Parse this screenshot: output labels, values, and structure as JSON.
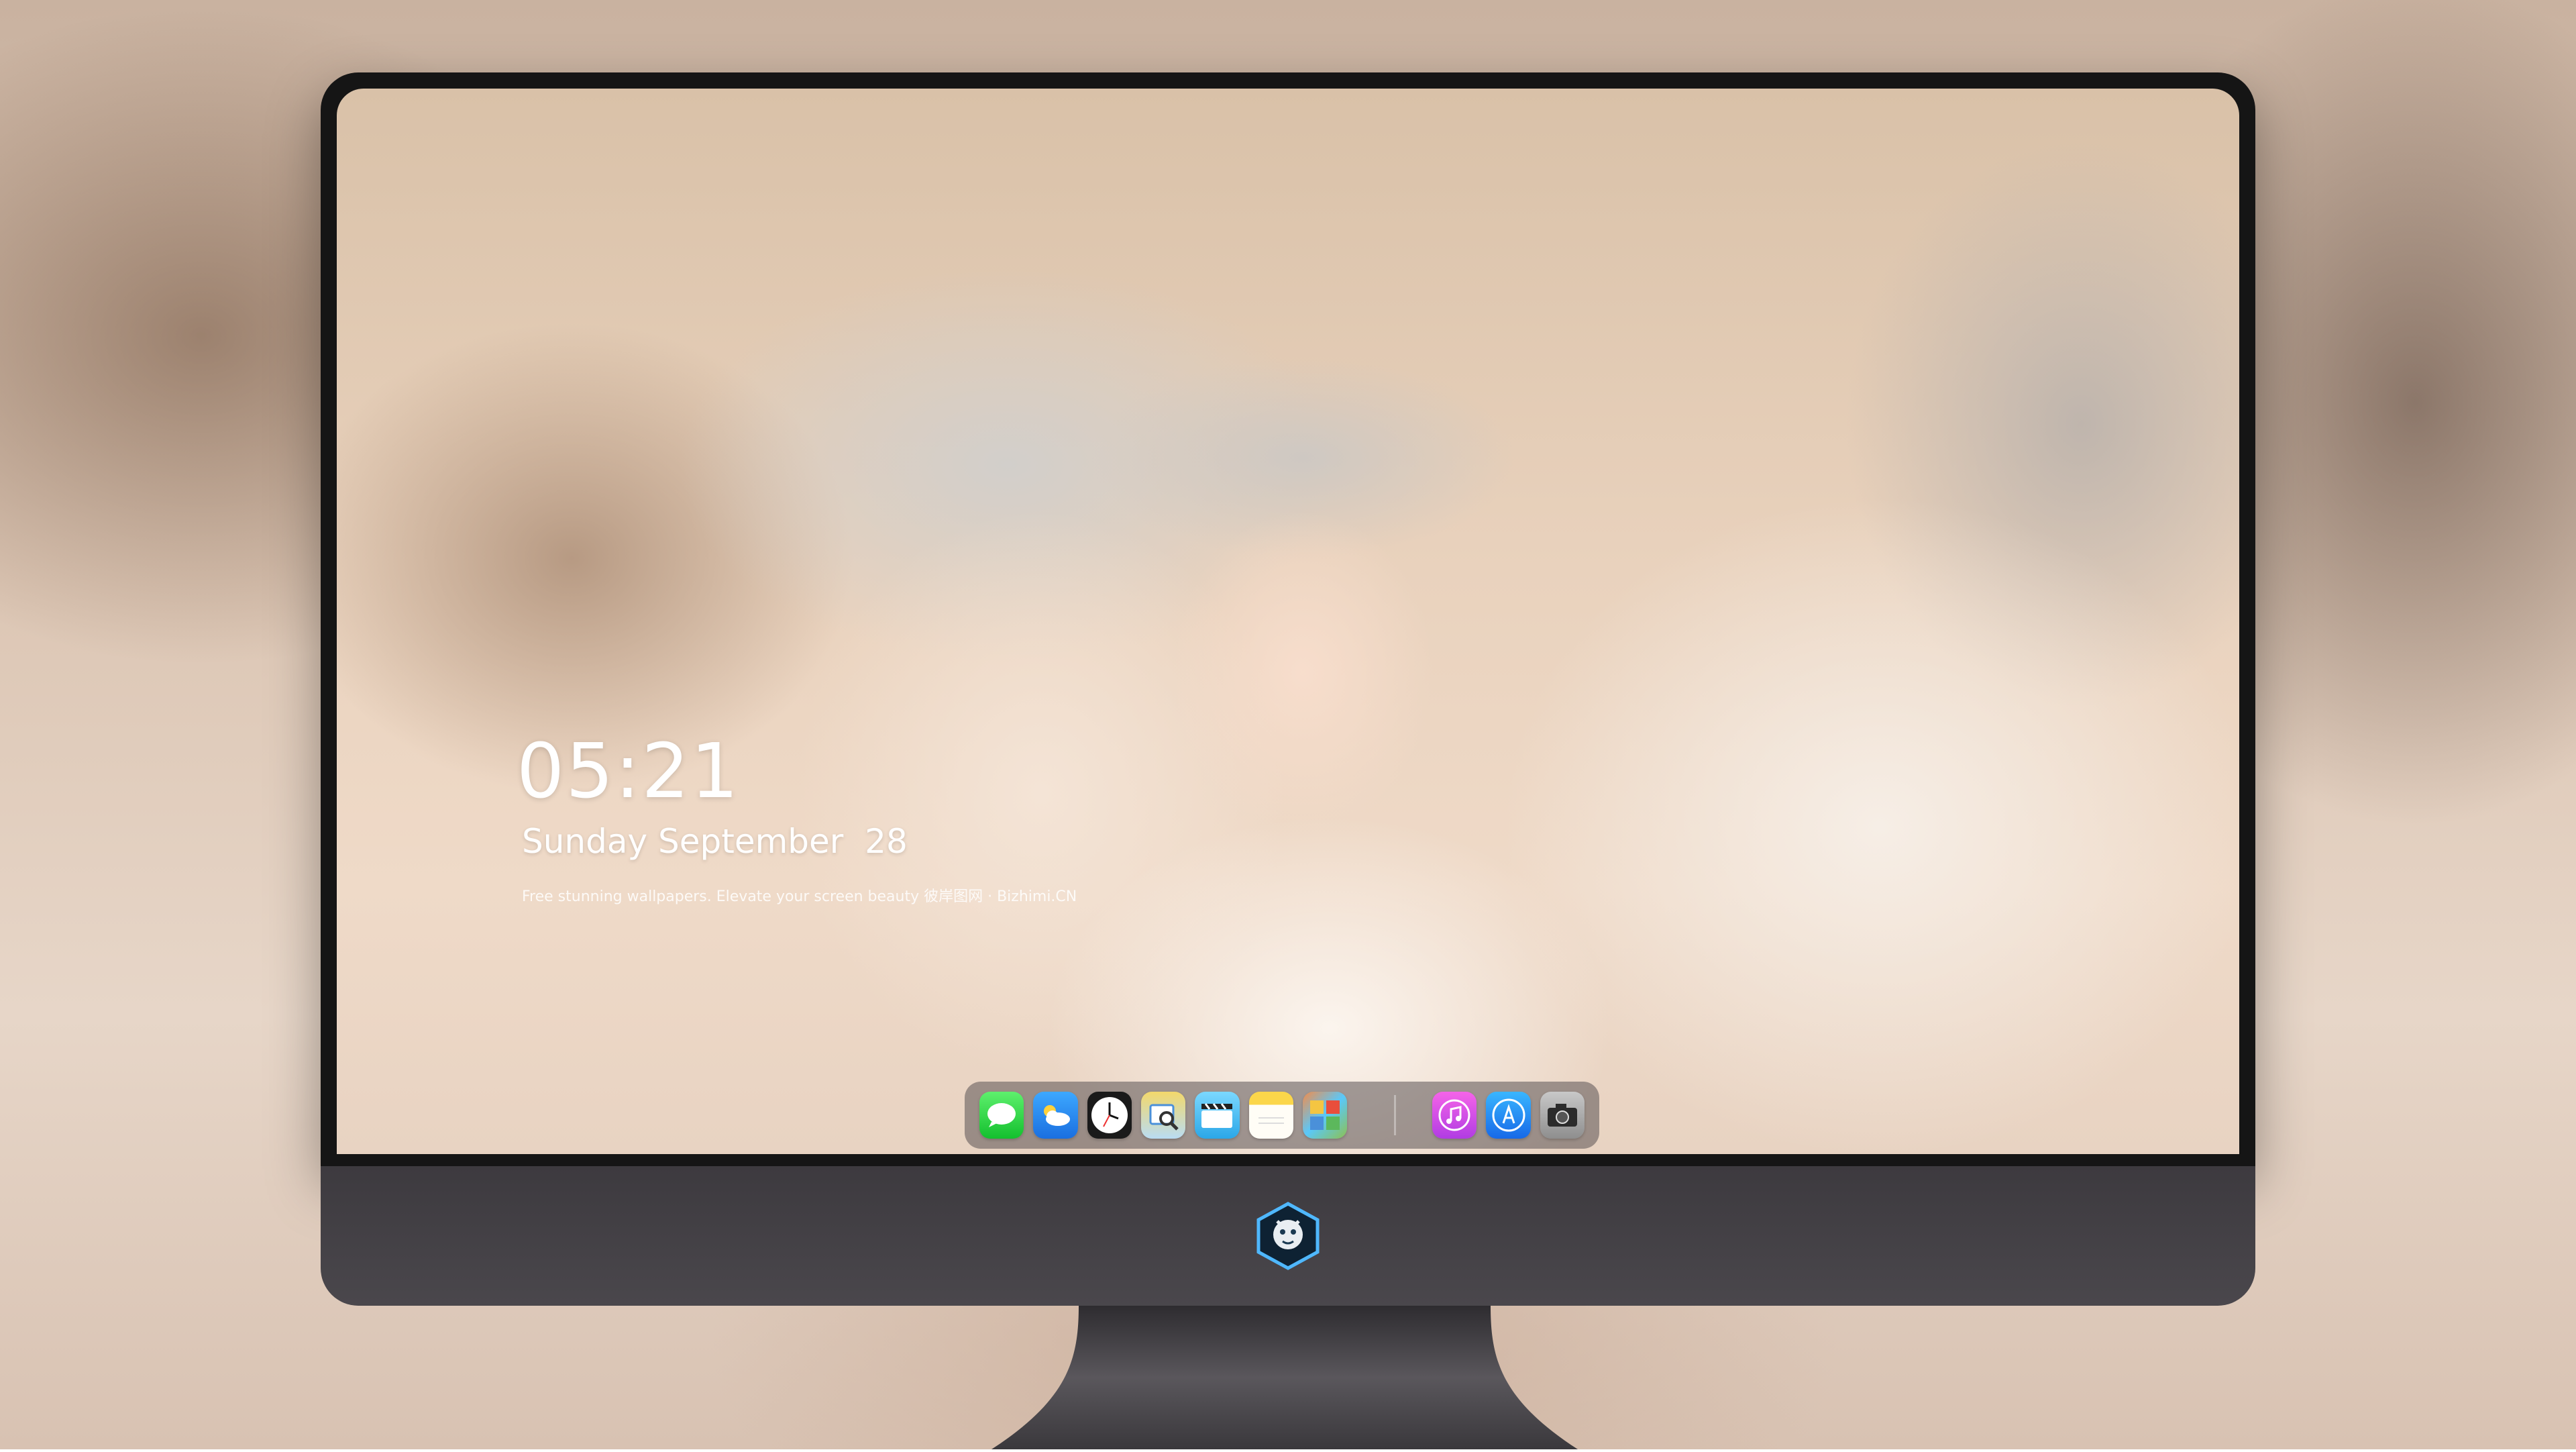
{
  "lockscreen": {
    "time": "05:21",
    "date": "Sunday September  28",
    "tagline": "Free stunning wallpapers. Elevate your screen beauty  彼岸图网 · Bizhimi.CN"
  },
  "dock": {
    "apps": [
      {
        "name": "messages-icon",
        "glyph": "💬"
      },
      {
        "name": "weather-icon",
        "glyph": "☁"
      },
      {
        "name": "clock-icon",
        "glyph": "🕓"
      },
      {
        "name": "preview-icon",
        "glyph": "🔍"
      },
      {
        "name": "clips-icon",
        "glyph": "🎬"
      },
      {
        "name": "notes-icon",
        "glyph": ""
      },
      {
        "name": "photos-icon",
        "glyph": ""
      }
    ],
    "apps_right": [
      {
        "name": "music-icon",
        "glyph": "♫"
      },
      {
        "name": "app-store-icon",
        "glyph": "Ⓐ"
      },
      {
        "name": "camera-icon",
        "glyph": "📷"
      }
    ]
  }
}
